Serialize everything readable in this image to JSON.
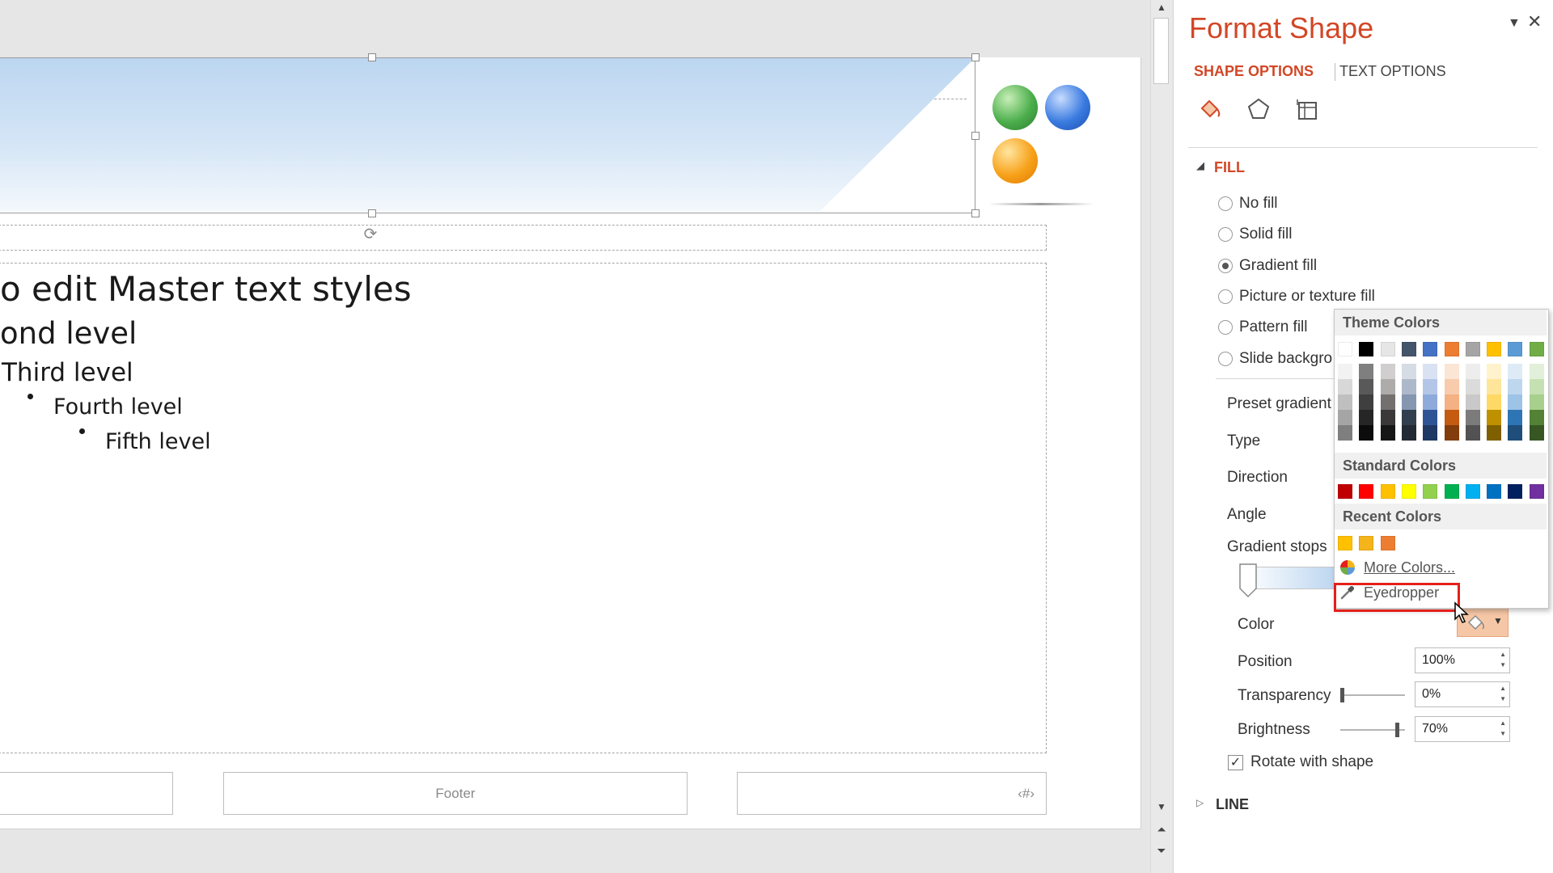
{
  "slide": {
    "bullets": {
      "level1": "o edit Master text styles",
      "level2": "ond level",
      "level3": "Third level",
      "level4": "Fourth level",
      "level5": "Fifth level"
    },
    "footer_text": "Footer",
    "page_number_text": "‹#›"
  },
  "pane": {
    "title": "Format Shape",
    "tabs": {
      "shape_options": "SHAPE OPTIONS",
      "text_options": "TEXT OPTIONS"
    },
    "fill_section": "FILL",
    "fill_options": {
      "no_fill": "No fill",
      "solid_fill": "Solid fill",
      "gradient_fill": "Gradient fill",
      "picture_fill": "Picture or texture fill",
      "pattern_fill": "Pattern fill",
      "slide_background": "Slide backgro"
    },
    "selected_fill": "gradient_fill",
    "labels": {
      "preset_gradient": "Preset gradient",
      "type": "Type",
      "direction": "Direction",
      "angle": "Angle",
      "gradient_stops": "Gradient stops",
      "color": "Color",
      "position": "Position",
      "transparency": "Transparency",
      "brightness": "Brightness",
      "rotate_with_shape": "Rotate with shape"
    },
    "values": {
      "position": "100%",
      "transparency": "0%",
      "brightness": "70%"
    },
    "rotate_with_shape_checked": true,
    "line_section": "LINE",
    "accent_color": "#d24726"
  },
  "color_menu": {
    "theme_colors_label": "Theme Colors",
    "standard_colors_label": "Standard Colors",
    "recent_colors_label": "Recent Colors",
    "theme_top_row": [
      "#ffffff",
      "#000000",
      "#e7e6e6",
      "#44546a",
      "#4472c4",
      "#ed7d31",
      "#a5a5a5",
      "#ffc000",
      "#5b9bd5",
      "#70ad47"
    ],
    "theme_shades": [
      [
        "#f2f2f2",
        "#7f7f7f",
        "#d0cece",
        "#d6dce4",
        "#d9e2f3",
        "#fbe5d5",
        "#ededed",
        "#fff2cc",
        "#deebf6",
        "#e2efd9"
      ],
      [
        "#d8d8d8",
        "#595959",
        "#aeabab",
        "#adb9ca",
        "#b4c6e7",
        "#f7cbac",
        "#dbdbdb",
        "#fee599",
        "#bdd7ee",
        "#c5e0b3"
      ],
      [
        "#bfbfbf",
        "#3f3f3f",
        "#757070",
        "#8496b0",
        "#8eaadb",
        "#f4b183",
        "#c9c9c9",
        "#ffd965",
        "#9dc3e6",
        "#a8d08d"
      ],
      [
        "#a5a5a5",
        "#262626",
        "#3a3838",
        "#323f4f",
        "#2f5496",
        "#c55a11",
        "#7b7b7b",
        "#bf9000",
        "#2e75b5",
        "#538135"
      ],
      [
        "#7f7f7f",
        "#0c0c0c",
        "#171616",
        "#222a35",
        "#1f3864",
        "#833c0b",
        "#525252",
        "#7f6000",
        "#1e4e79",
        "#375623"
      ]
    ],
    "standard": [
      "#c00000",
      "#ff0000",
      "#ffc000",
      "#ffff00",
      "#92d050",
      "#00b050",
      "#00b0f0",
      "#0070c0",
      "#002060",
      "#7030a0"
    ],
    "recent": [
      "#ffc000",
      "#f4b41a",
      "#ed7d31"
    ],
    "more_colors": "More Colors...",
    "eyedropper": "Eyedropper"
  }
}
